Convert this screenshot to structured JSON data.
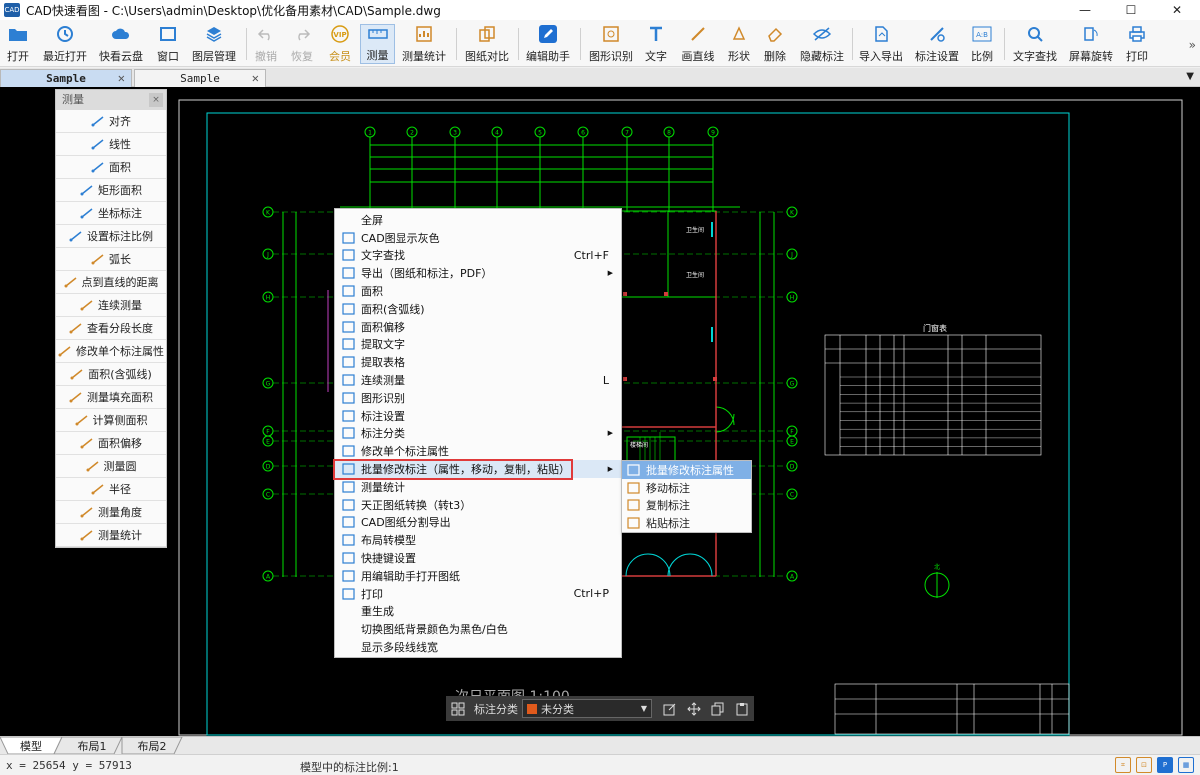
{
  "window": {
    "app_icon": "CAD",
    "title": "CAD快速看图 - C:\\Users\\admin\\Desktop\\优化备用素材\\CAD\\Sample.dwg",
    "controls": [
      "—",
      "☐",
      "✕"
    ]
  },
  "toolbar": {
    "open": "打开",
    "recent": "最近打开",
    "cloud": "快看云盘",
    "window": "窗口",
    "layers": "图层管理",
    "undo": "撤销",
    "redo": "恢复",
    "vip": "会员",
    "measure": "测量",
    "measure_stats": "测量统计",
    "compare": "图纸对比",
    "edit_assistant": "编辑助手",
    "shape_recog": "图形识别",
    "text": "文字",
    "line": "画直线",
    "shape": "形状",
    "delete": "删除",
    "hide_annot": "隐藏标注",
    "import_export": "导入导出",
    "annot_settings": "标注设置",
    "scale": "比例",
    "text_search": "文字查找",
    "rotate": "屏幕旋转",
    "print": "打印",
    "overflow": "»"
  },
  "tabs": [
    {
      "label": "Sample",
      "close": "✕"
    },
    {
      "label": "Sample",
      "close": "✕"
    }
  ],
  "measure_panel": {
    "title": "测量",
    "close": "×",
    "items": [
      "对齐",
      "线性",
      "面积",
      "矩形面积",
      "坐标标注",
      "设置标注比例",
      "弧长",
      "点到直线的距离",
      "连续测量",
      "查看分段长度",
      "修改单个标注属性",
      "面积(含弧线)",
      "测量填充面积",
      "计算侧面积",
      "面积偏移",
      "测量圆",
      "半径",
      "测量角度",
      "测量统计"
    ]
  },
  "context_menu": {
    "items": [
      {
        "label": "全屏",
        "shortcut": "",
        "submenu": false
      },
      {
        "label": "CAD图显示灰色",
        "shortcut": "",
        "submenu": false
      },
      {
        "label": "文字查找",
        "shortcut": "Ctrl+F",
        "submenu": false
      },
      {
        "label": "导出（图纸和标注，PDF）",
        "shortcut": "",
        "submenu": true
      },
      {
        "label": "面积",
        "shortcut": "",
        "submenu": false
      },
      {
        "label": "面积(含弧线)",
        "shortcut": "",
        "submenu": false
      },
      {
        "label": "面积偏移",
        "shortcut": "",
        "submenu": false
      },
      {
        "label": "提取文字",
        "shortcut": "",
        "submenu": false
      },
      {
        "label": "提取表格",
        "shortcut": "",
        "submenu": false
      },
      {
        "label": "连续测量",
        "shortcut": "L",
        "submenu": false
      },
      {
        "label": "图形识别",
        "shortcut": "",
        "submenu": false
      },
      {
        "label": "标注设置",
        "shortcut": "",
        "submenu": false
      },
      {
        "label": "标注分类",
        "shortcut": "",
        "submenu": true
      },
      {
        "label": "修改单个标注属性",
        "shortcut": "",
        "submenu": false
      },
      {
        "label": "批量修改标注（属性，移动，复制，粘贴）",
        "shortcut": "",
        "submenu": true
      },
      {
        "label": "测量统计",
        "shortcut": "",
        "submenu": false
      },
      {
        "label": "天正图纸转换（转t3）",
        "shortcut": "",
        "submenu": false
      },
      {
        "label": "CAD图纸分割导出",
        "shortcut": "",
        "submenu": false
      },
      {
        "label": "布局转模型",
        "shortcut": "",
        "submenu": false
      },
      {
        "label": "快捷键设置",
        "shortcut": "",
        "submenu": false
      },
      {
        "label": "用编辑助手打开图纸",
        "shortcut": "",
        "submenu": false
      },
      {
        "label": "打印",
        "shortcut": "Ctrl+P",
        "submenu": false
      },
      {
        "label": "重生成",
        "shortcut": "",
        "submenu": false
      },
      {
        "label": "切换图纸背景颜色为黑色/白色",
        "shortcut": "",
        "submenu": false
      },
      {
        "label": "显示多段线线宽",
        "shortcut": "",
        "submenu": false
      }
    ],
    "highlighted_index": 14
  },
  "submenu": {
    "items": [
      "批量修改标注属性",
      "移动标注",
      "复制标注",
      "粘贴标注"
    ],
    "highlighted_index": 0
  },
  "drawing": {
    "table_title": "门窗表",
    "grid_top": [
      "1",
      "2",
      "3",
      "4",
      "5",
      "6",
      "7",
      "8",
      "9"
    ],
    "grid_left": [
      "K",
      "J",
      "H",
      "G",
      "F",
      "E",
      "D",
      "C",
      "A"
    ],
    "room_labels": [
      "卫生间",
      "卫生间",
      "楼梯间"
    ],
    "north_label": "北",
    "plan_title": "次日平面图 1:100"
  },
  "annotation_bar": {
    "label": "标注分类",
    "category": "未分类",
    "swatch_color": "#e05a1c"
  },
  "layout_tabs": [
    "模型",
    "布局1",
    "布局2"
  ],
  "status": {
    "coords": "x = 25654 y = 57913",
    "scale_text": "模型中的标注比例:1"
  },
  "colors": {
    "canvas_bg": "#000000",
    "cad_green": "#00e000",
    "cad_cyan": "#00d6d6",
    "highlight_red": "#e03a3a",
    "accent_blue": "#1f6fd1"
  }
}
